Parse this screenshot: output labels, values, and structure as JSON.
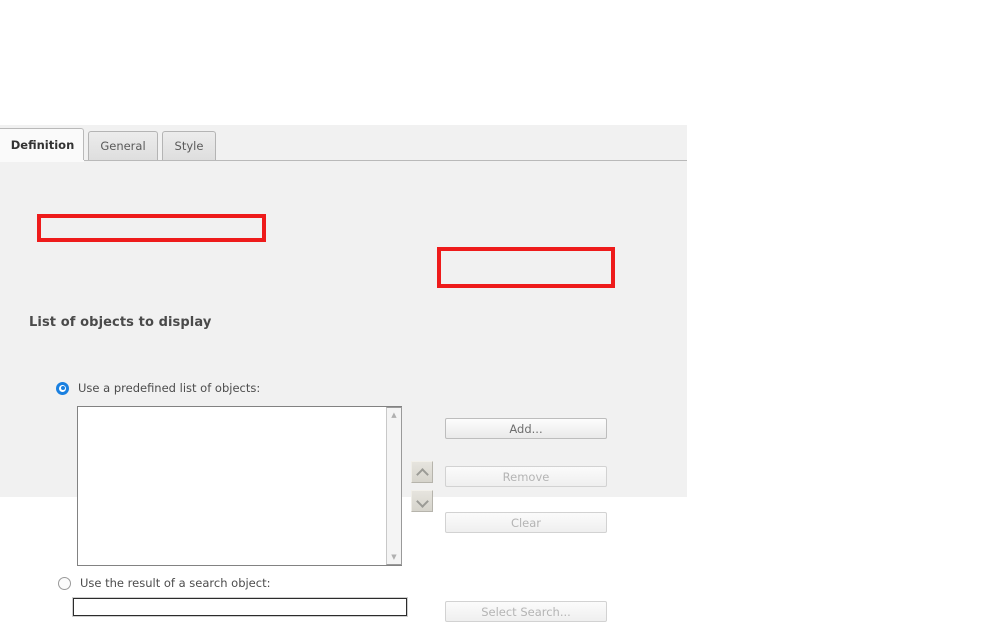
{
  "dialog": {
    "tabs": [
      {
        "id": "definition",
        "label": "Definition",
        "active": true
      },
      {
        "id": "general",
        "label": "General",
        "active": false
      },
      {
        "id": "style",
        "label": "Style",
        "active": false
      }
    ],
    "section_title": "List of objects to display",
    "options": {
      "predefined": {
        "label": "Use a predefined list of objects:",
        "selected": true
      },
      "search": {
        "label": "Use the result of a search object:",
        "selected": false
      }
    },
    "listbox": {
      "items": [],
      "scroll_up_icon": "scroll-up-arrow-icon",
      "scroll_down_icon": "scroll-down-arrow-icon"
    },
    "reorder": {
      "up_icon": "chevron-up-icon",
      "down_icon": "chevron-down-icon"
    },
    "buttons": {
      "add": {
        "label": "Add...",
        "enabled": true
      },
      "remove": {
        "label": "Remove",
        "enabled": false
      },
      "clear": {
        "label": "Clear",
        "enabled": false
      },
      "select_search": {
        "label": "Select Search...",
        "enabled": false
      }
    },
    "search_input": {
      "value": "",
      "placeholder": ""
    }
  },
  "annotations": {
    "highlight_color": "#ee1b1b",
    "targets": [
      "Use a predefined list of objects:",
      "Add..."
    ]
  }
}
